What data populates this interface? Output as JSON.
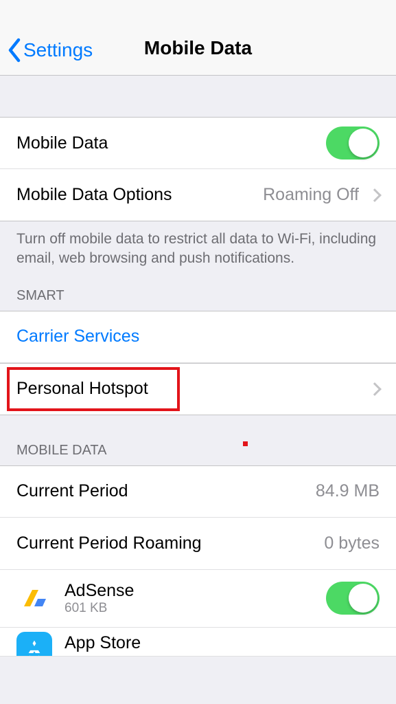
{
  "nav": {
    "back_label": "Settings",
    "title": "Mobile Data"
  },
  "section1": {
    "mobile_data_label": "Mobile Data",
    "options_label": "Mobile Data Options",
    "options_detail": "Roaming Off",
    "footer": "Turn off mobile data to restrict all data to Wi-Fi, including email, web browsing and push notifications."
  },
  "section2": {
    "header": "SMART",
    "carrier_label": "Carrier Services",
    "hotspot_label": "Personal Hotspot"
  },
  "section3": {
    "header": "MOBILE DATA",
    "current_period_label": "Current Period",
    "current_period_value": "84.9 MB",
    "roaming_label": "Current Period Roaming",
    "roaming_value": "0 bytes",
    "apps": [
      {
        "name": "AdSense",
        "usage": "601 KB"
      },
      {
        "name": "App Store",
        "usage": ""
      }
    ]
  }
}
